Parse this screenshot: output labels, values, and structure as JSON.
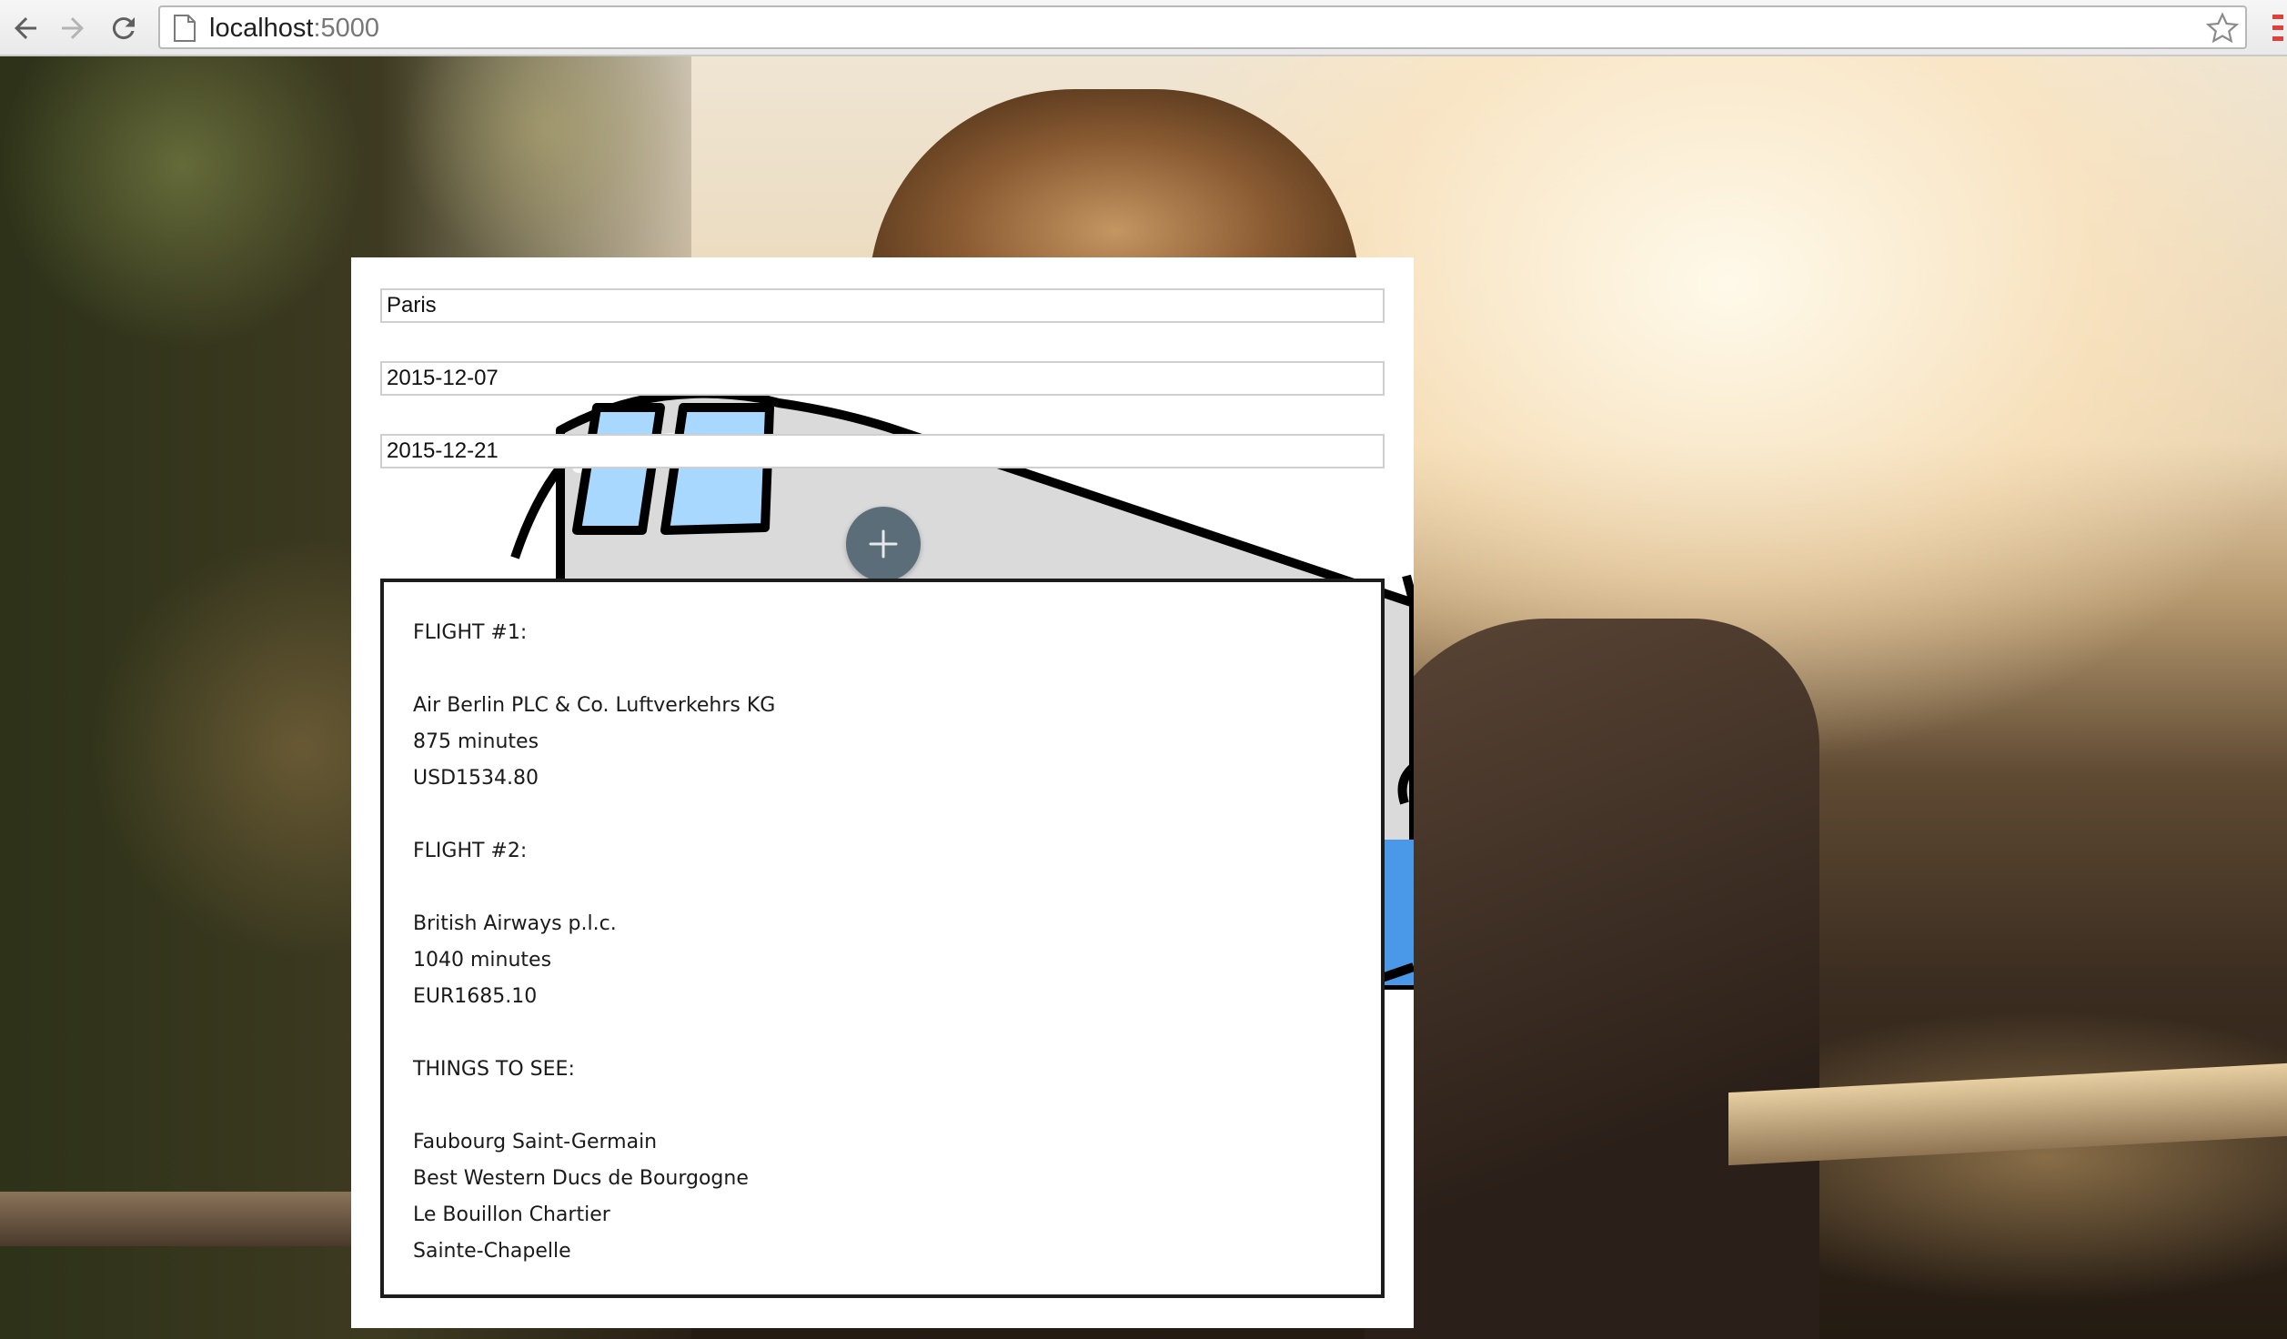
{
  "browser": {
    "url_host": "localhost",
    "url_port": ":5000",
    "back_icon": "arrow-left-icon",
    "forward_icon": "arrow-right-icon",
    "reload_icon": "reload-icon",
    "page_icon": "page-icon",
    "bookmark_icon": "star-icon",
    "menu_icon": "menu-icon"
  },
  "form": {
    "city": "Paris",
    "start_date": "2015-12-07",
    "end_date": "2015-12-21",
    "add_icon": "plus-icon",
    "add_color": "#5b6d78"
  },
  "results": {
    "flight1": {
      "heading": "FLIGHT #1:",
      "airline": "Air Berlin PLC & Co. Luftverkehrs KG",
      "duration": "875 minutes",
      "price": "USD1534.80"
    },
    "flight2": {
      "heading": "FLIGHT #2:",
      "airline": "British Airways p.l.c.",
      "duration": "1040 minutes",
      "price": "EUR1685.10"
    },
    "things": {
      "heading": "THINGS TO SEE:",
      "items": [
        "Faubourg Saint-Germain",
        "Best Western Ducs de Bourgogne",
        "Le Bouillon Chartier",
        "Sainte-Chapelle"
      ]
    }
  }
}
